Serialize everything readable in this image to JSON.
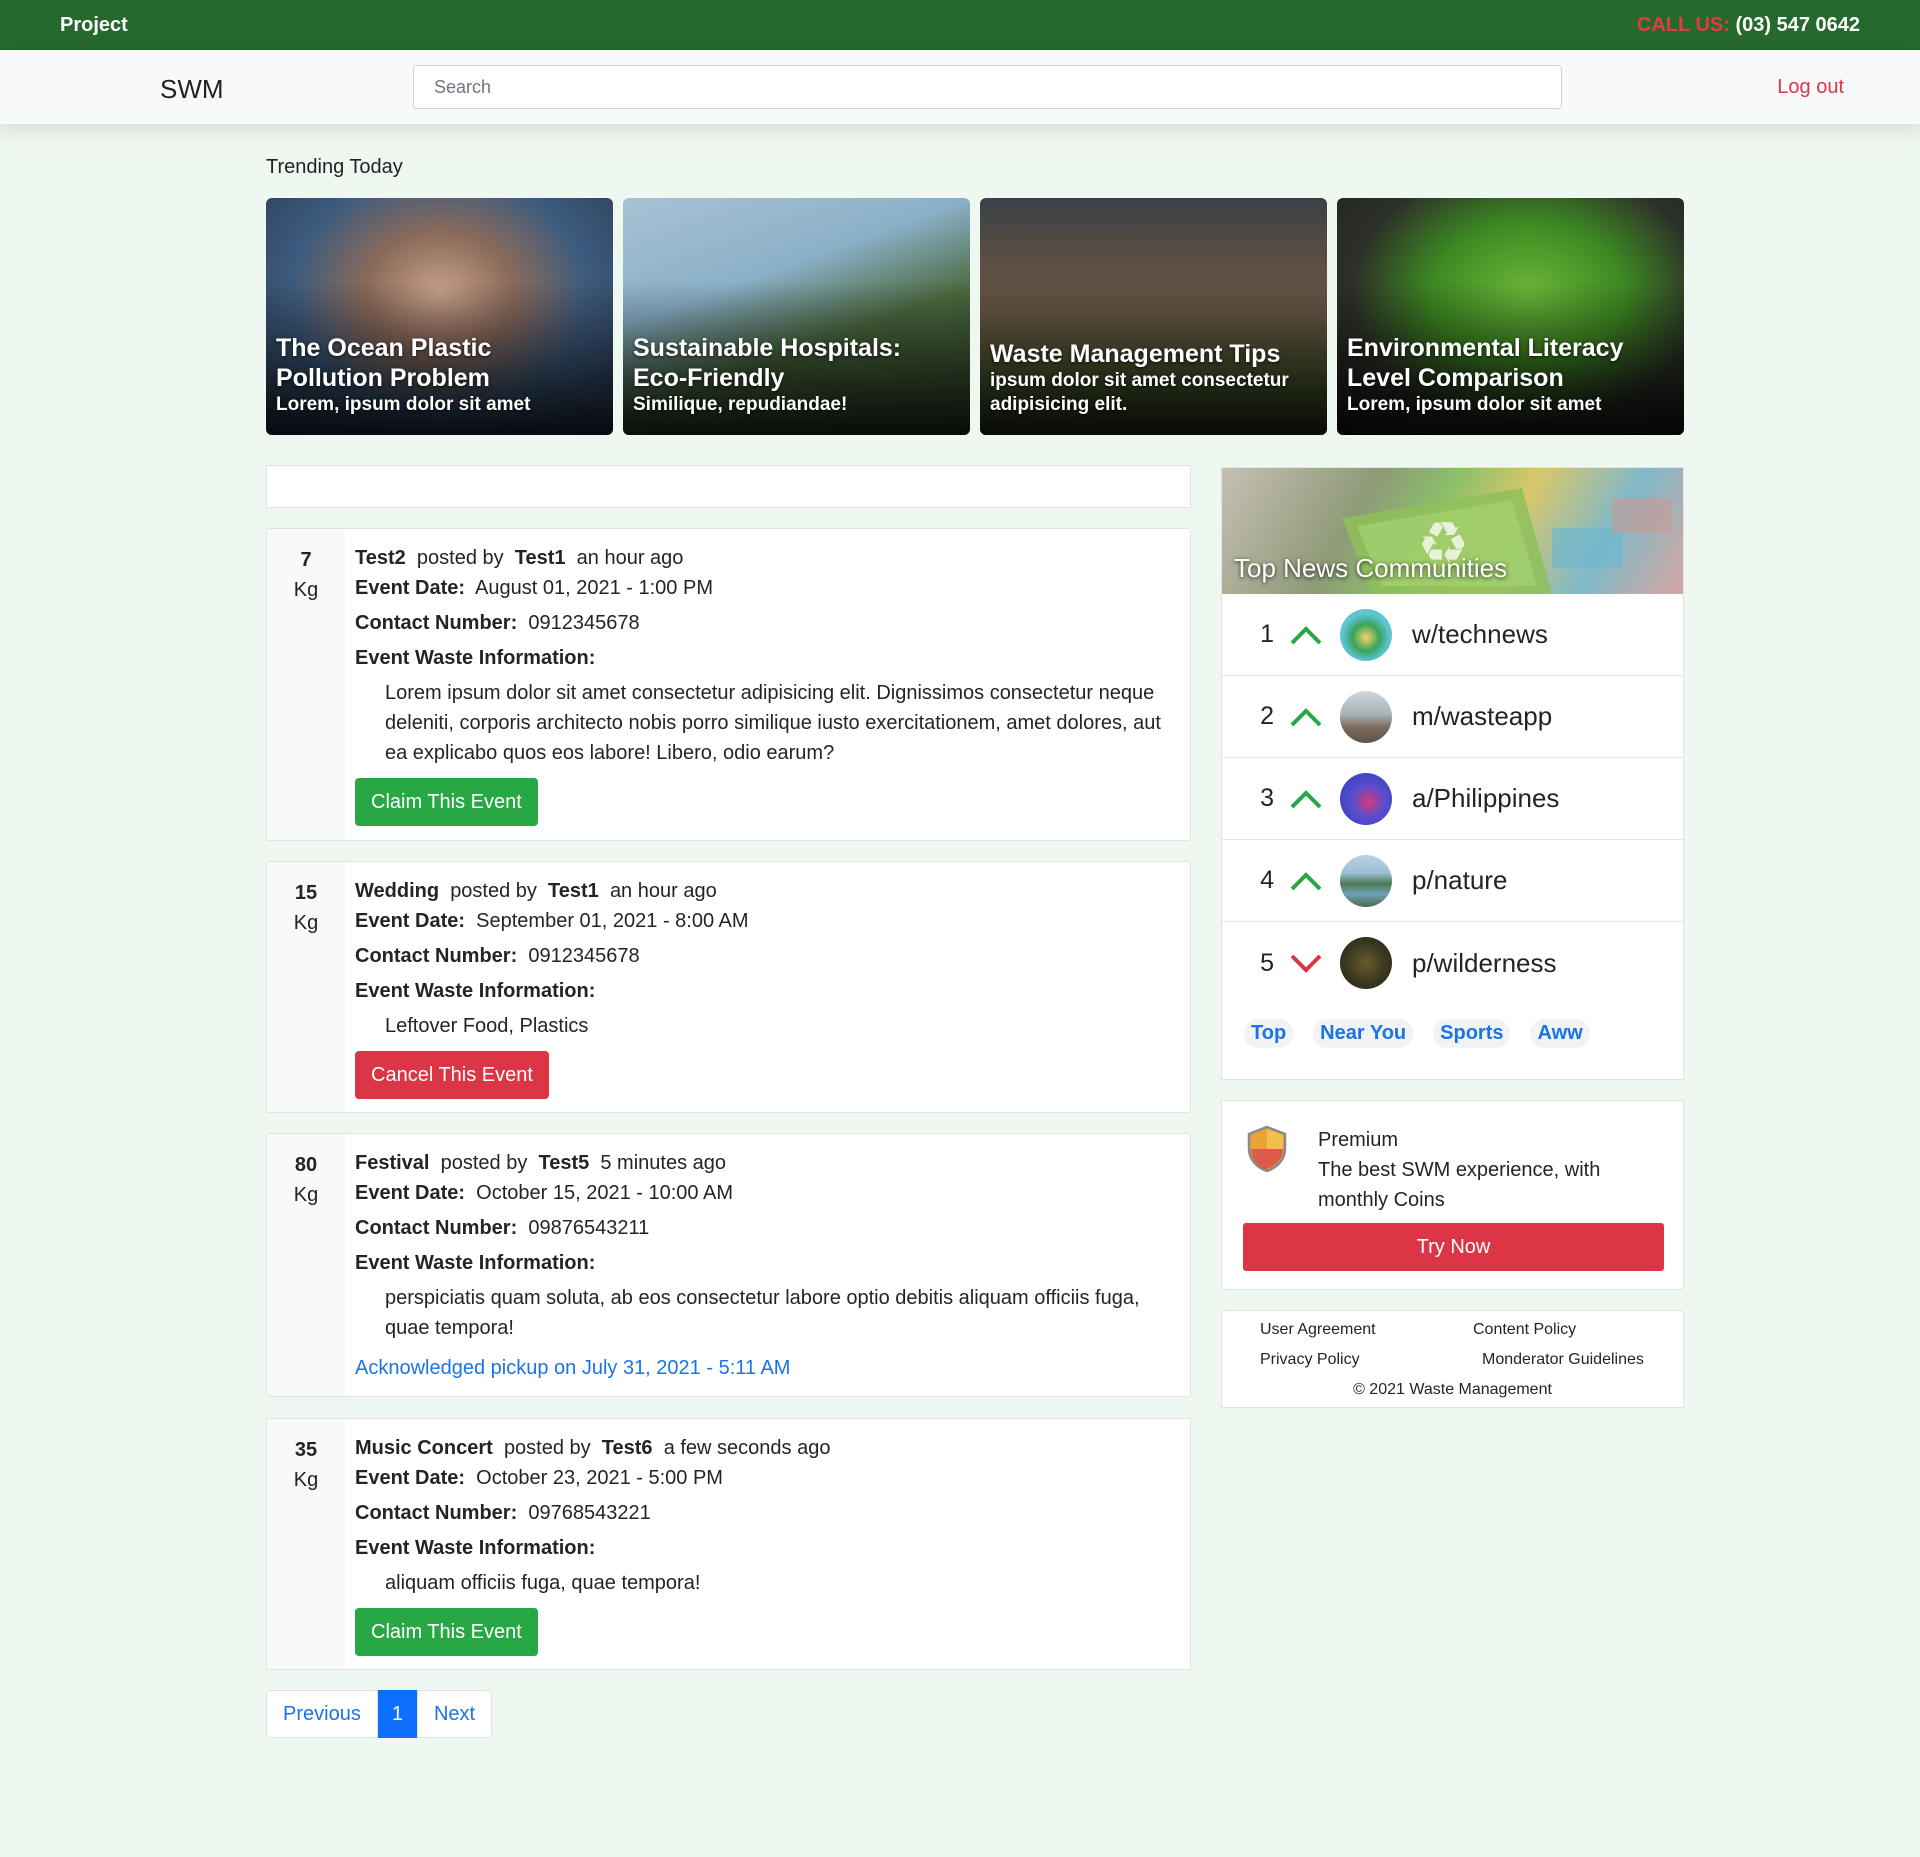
{
  "topbar": {
    "brand": "Project",
    "call_label": "CALL US:",
    "call_number": "(03) 547 0642"
  },
  "navbar": {
    "logo": "SWM",
    "search_placeholder": "Search",
    "logout": "Log out"
  },
  "trending": {
    "title": "Trending Today",
    "cards": [
      {
        "heading": "The Ocean Plastic Pollution Problem",
        "sub": "Lorem, ipsum dolor sit amet"
      },
      {
        "heading": "Sustainable Hospitals: Eco-Friendly",
        "sub": "Similique, repudiandae!"
      },
      {
        "heading": "Waste Management Tips",
        "sub": "ipsum dolor sit amet consectetur adipisicing elit."
      },
      {
        "heading": "Environmental Literacy Level Comparison",
        "sub": "Lorem, ipsum dolor sit amet"
      }
    ]
  },
  "labels": {
    "posted_by": "posted by",
    "event_date": "Event Date:",
    "contact_number": "Contact Number:",
    "waste_info": "Event Waste Information:",
    "unit": "Kg"
  },
  "posts": [
    {
      "weight": "7",
      "title": "Test2",
      "author": "Test1",
      "time": "an hour ago",
      "date": "August 01, 2021 - 1:00 PM",
      "contact": "0912345678",
      "info": "Lorem ipsum dolor sit amet consectetur adipisicing elit. Dignissimos consectetur neque deleniti, corporis architecto nobis porro similique iusto exercitationem, amet dolores, aut ea explicabo quos eos labore! Libero, odio earum?",
      "action": "Claim This Event"
    },
    {
      "weight": "15",
      "title": "Wedding",
      "author": "Test1",
      "time": "an hour ago",
      "date": "September 01, 2021 - 8:00 AM",
      "contact": "0912345678",
      "info": "Leftover Food, Plastics",
      "action": "Cancel This Event"
    },
    {
      "weight": "80",
      "title": "Festival",
      "author": "Test5",
      "time": "5 minutes ago",
      "date": "October 15, 2021 - 10:00 AM",
      "contact": "09876543211",
      "info": "perspiciatis quam soluta, ab eos consectetur labore optio debitis aliquam officiis fuga, quae tempora!",
      "status": "Acknowledged pickup on July 31, 2021 - 5:11 AM"
    },
    {
      "weight": "35",
      "title": "Music Concert",
      "author": "Test6",
      "time": "a few seconds ago",
      "date": "October 23, 2021 - 5:00 PM",
      "contact": "09768543221",
      "info": "aliquam officiis fuga, quae tempora!",
      "action": "Claim This Event"
    }
  ],
  "pagination": {
    "previous": "Previous",
    "current": "1",
    "next": "Next"
  },
  "communities": {
    "title": "Top News Communities",
    "items": [
      {
        "rank": "1",
        "name": "w/technews",
        "trend": "up"
      },
      {
        "rank": "2",
        "name": "m/wasteapp",
        "trend": "up"
      },
      {
        "rank": "3",
        "name": "a/Philippines",
        "trend": "up"
      },
      {
        "rank": "4",
        "name": "p/nature",
        "trend": "up"
      },
      {
        "rank": "5",
        "name": "p/wilderness",
        "trend": "down"
      }
    ],
    "tags": [
      "Top",
      "Near You",
      "Sports",
      "Aww"
    ]
  },
  "premium": {
    "title": "Premium",
    "text": "The best SWM experience, with monthly Coins",
    "button": "Try Now"
  },
  "footer": {
    "user_agreement": "User Agreement",
    "content_policy": "Content Policy",
    "privacy_policy": "Privacy Policy",
    "moderator_guidelines": "Monderator Guidelines",
    "copyright": "© 2021 Waste Management"
  },
  "colors": {
    "topbar": "#26692c",
    "background": "#eff8f0",
    "accent_red": "#dc3545",
    "accent_green": "#28a745",
    "link_blue": "#1a73e8",
    "trend_up": "#28a745",
    "trend_down": "#dc3545"
  }
}
